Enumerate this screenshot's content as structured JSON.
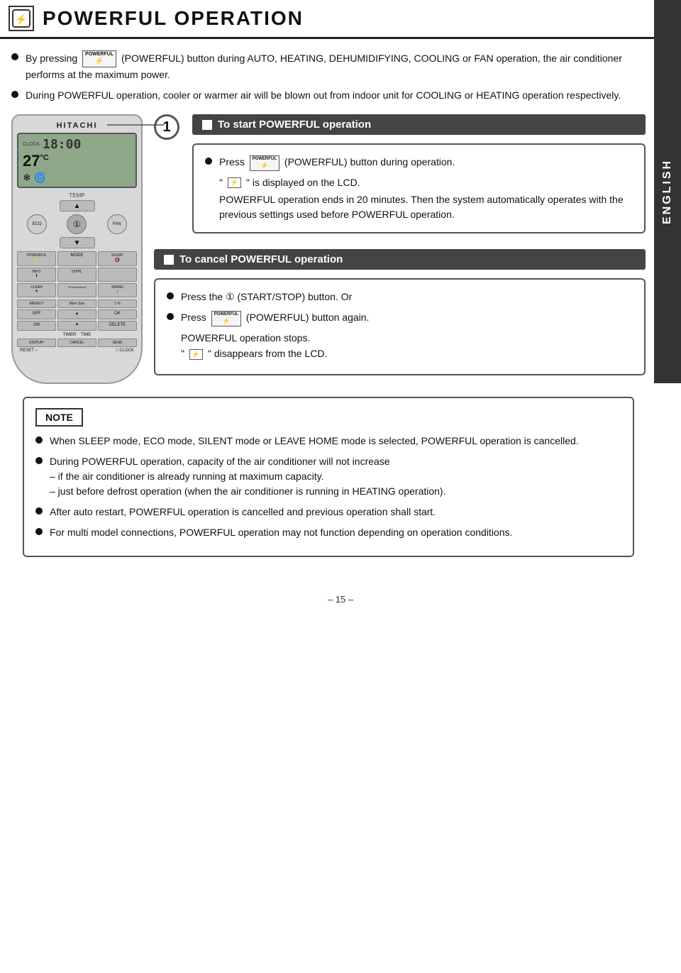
{
  "page": {
    "title": "POWERFUL OPERATION",
    "page_number": "– 15 –",
    "english_label": "ENGLISH"
  },
  "header": {
    "icon_text": "⚡"
  },
  "bullets": [
    {
      "text": "By pressing  (POWERFUL) button during AUTO, HEATING, DEHUMIDIFYING, COOLING or FAN operation, the air conditioner performs at the maximum power."
    },
    {
      "text": "During POWERFUL operation, cooler or warmer air will be blown out from indoor unit for COOLING or HEATING operation respectively."
    }
  ],
  "remote": {
    "brand": "HITACHI",
    "clock_label": "CLOCK",
    "time": "18:00",
    "temp": "27",
    "temp_unit": "°C",
    "temp_label": "TEMP",
    "buttons": {
      "eco_label": "ECO",
      "fan_label": "FAN",
      "powerful_label": "POWERFUL",
      "mode_label": "MODE",
      "silent_label": "SILENT",
      "info_label": "INFO",
      "displ_label": "DISPL",
      "clean_label": "CLEAN",
      "leave_home_label": "⊙Leave Home",
      "swing_label": "SWING",
      "weekly_label": "WEEKLY",
      "mon_sun_label": "Mon~Sun",
      "range_label": "1~6",
      "off_label": "OFF",
      "on_label": "ON",
      "ok_label": "OK",
      "time_label": "TIME",
      "delete_label": "DELETE",
      "display_label": "DISPLAY",
      "cancel_label": "CANCEL",
      "send_label": "SEND",
      "reset_label": "RESET",
      "clock_btn_label": "CLOCK"
    }
  },
  "start_section": {
    "header": "To start POWERFUL operation",
    "step_number": "1",
    "bullet1": "Press  (POWERFUL) button during operation.",
    "bullet1_btn": "POWERFUL",
    "bullet2_pre": "\"",
    "bullet2_icon": "⚡",
    "bullet2_post": "\" is displayed on the LCD.",
    "paragraph": "POWERFUL operation ends in 20 minutes. Then the system automatically operates with the previous settings used before POWERFUL operation."
  },
  "cancel_section": {
    "header": "To cancel POWERFUL operation",
    "bullet1": "Press the ① (START/STOP) button. Or",
    "bullet2_pre": "Press",
    "bullet2_btn": "POWERFUL",
    "bullet2_post": "(POWERFUL) button again.",
    "paragraph1": "POWERFUL operation stops.",
    "bullet3_pre": "\"",
    "bullet3_icon": "⚡",
    "bullet3_post": "\" disappears from the LCD."
  },
  "note": {
    "header": "NOTE",
    "items": [
      "When SLEEP mode, ECO mode, SILENT mode or LEAVE HOME mode is selected, POWERFUL operation is cancelled.",
      "During POWERFUL operation, capacity of the air conditioner will not increase\n– if the air conditioner is already running at maximum capacity.\n– just before defrost operation (when the air conditioner is running in HEATING operation).",
      "After auto restart, POWERFUL operation is cancelled and previous operation shall start.",
      "For multi model connections, POWERFUL operation may not function depending on operation conditions."
    ]
  }
}
